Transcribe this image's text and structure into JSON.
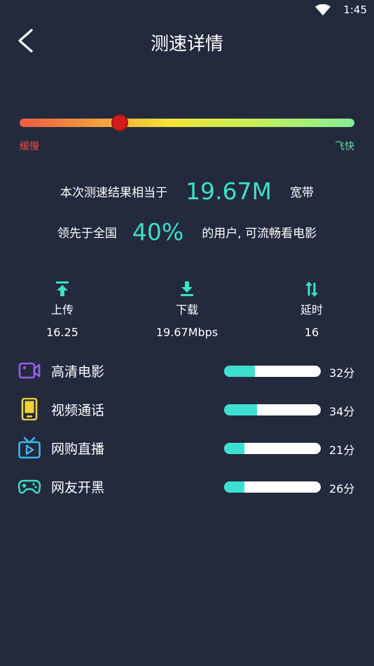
{
  "status_bar": {
    "time": "1:45"
  },
  "header": {
    "title": "测速详情"
  },
  "speed": {
    "slow_label": "缓慢",
    "fast_label": "飞快",
    "level": 0.3
  },
  "result": {
    "line1_prefix": "本次测速结果相当于",
    "line1_value": "19.67M",
    "line1_suffix": "宽带",
    "line2_prefix": "领先于全国",
    "line2_value": "40%",
    "line2_suffix": "的用户, 可流畅看电影"
  },
  "stats": [
    {
      "label": "上传",
      "value": "16.25",
      "icon": "upload-icon"
    },
    {
      "label": "下载",
      "value": "19.67Mbps",
      "icon": "download-icon"
    },
    {
      "label": "延时",
      "value": "16",
      "icon": "latency-icon"
    }
  ],
  "scores": [
    {
      "label": "高清电影",
      "value": "32分",
      "level": 0.32,
      "icon": "video-camera-icon",
      "color": "#9b5cf0"
    },
    {
      "label": "视频通话",
      "value": "34分",
      "level": 0.34,
      "icon": "phone-icon",
      "color": "#f0d23a"
    },
    {
      "label": "网购直播",
      "value": "21分",
      "level": 0.21,
      "icon": "tv-icon",
      "color": "#3fb6ef"
    },
    {
      "label": "网友开黑",
      "value": "26分",
      "level": 0.21,
      "icon": "gamepad-icon",
      "color": "#3de0c8"
    }
  ],
  "colors": {
    "accent": "#3de0c8",
    "background": "#232a3d",
    "slow": "#ef4d3f",
    "fast": "#62e39a"
  }
}
